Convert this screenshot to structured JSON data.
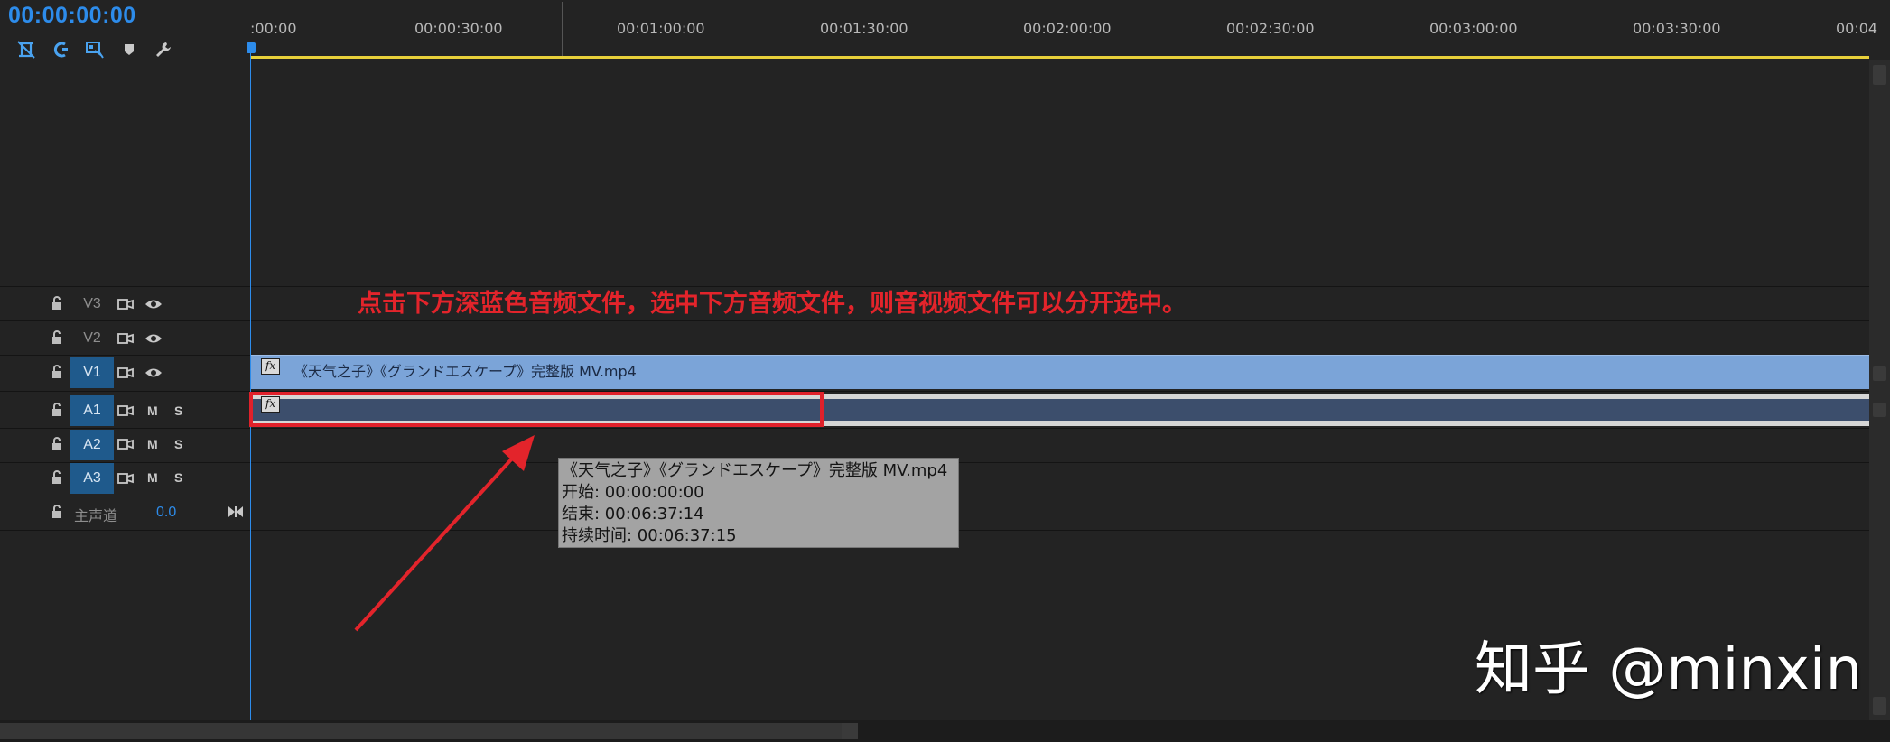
{
  "timecode": "00:00:00:00",
  "ruler_ticks": [
    ":00:00",
    "00:00:30:00",
    "00:01:00:00",
    "00:01:30:00",
    "00:02:00:00",
    "00:02:30:00",
    "00:03:00:00",
    "00:03:30:00",
    "00:04"
  ],
  "toolbar": {
    "icons": [
      "snap-icon",
      "linked-selection-icon",
      "add-marker-icon",
      "marker-icon",
      "wrench-icon"
    ]
  },
  "tracks": {
    "video": [
      {
        "name": "V3",
        "active": false
      },
      {
        "name": "V2",
        "active": false
      },
      {
        "name": "V1",
        "active": true
      }
    ],
    "audio": [
      {
        "name": "A1",
        "active": true,
        "m": "M",
        "s": "S"
      },
      {
        "name": "A2",
        "active": true,
        "m": "M",
        "s": "S"
      },
      {
        "name": "A3",
        "active": true,
        "m": "M",
        "s": "S"
      }
    ],
    "master": {
      "label": "主声道",
      "value": "0.0"
    }
  },
  "clips": {
    "v1": {
      "label": "《天气之子》《グランドエスケープ》完整版 MV.mp4",
      "fx": "fx"
    },
    "a1": {
      "fx": "fx"
    }
  },
  "annotation": "点击下方深蓝色音频文件，选中下方音频文件，则音视频文件可以分开选中。",
  "tooltip": {
    "title": "《天气之子》《グランドエスケープ》完整版 MV.mp4",
    "start": "开始: 00:00:00:00",
    "end": "结束: 00:06:37:14",
    "duration": "持续时间: 00:06:37:15"
  },
  "watermark": "知乎 @minxin",
  "colors": {
    "accent": "#2d8ceb",
    "video_clip": "#7ba4d8",
    "audio_clip": "#3c4e6c",
    "annotation_red": "#e3242b",
    "ruler_yellow": "#e8d03a"
  }
}
